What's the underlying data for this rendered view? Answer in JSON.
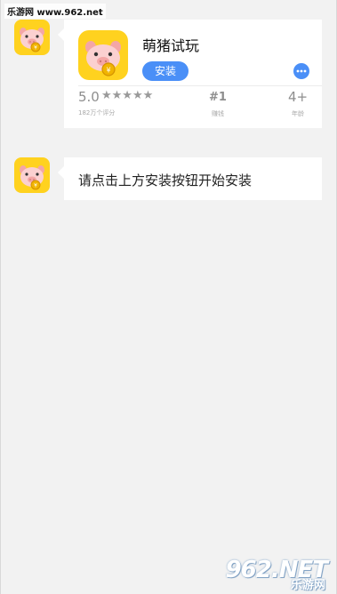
{
  "watermark": {
    "top_text": "乐游网 www.962.net",
    "bottom_logo": "962.NET",
    "bottom_text": "乐游网"
  },
  "app_card": {
    "app_name": "萌猪试玩",
    "install_label": "安装",
    "more_icon": "more-horizontal-icon",
    "rating_value": "5.0",
    "stars": "★★★★★",
    "rating_count": "182万个评分",
    "rank_value": "#1",
    "rank_label": "赚钱",
    "age_value": "4+",
    "age_label": "年龄"
  },
  "message": {
    "text": "请点击上方安装按钮开始安装"
  },
  "colors": {
    "accent": "#4a8ff7",
    "icon_yellow": "#ffd21f",
    "pig_pink": "#f9c2c2",
    "background": "#f2f2f2"
  }
}
